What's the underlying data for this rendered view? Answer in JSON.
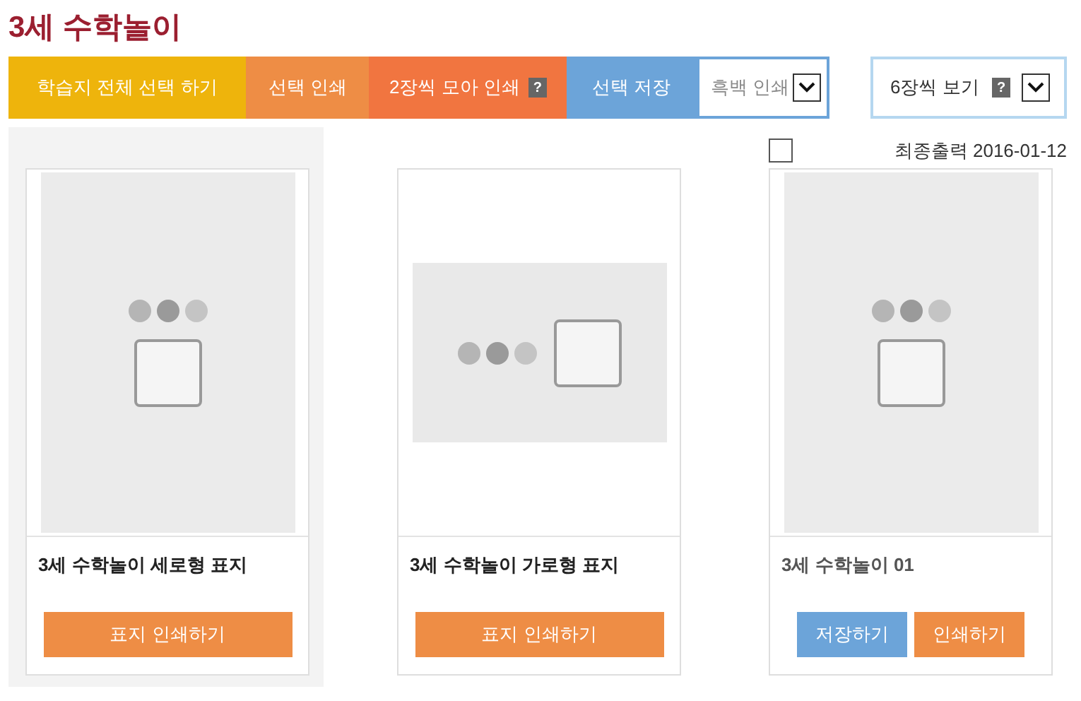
{
  "title": "3세 수학놀이",
  "toolbar": {
    "buttons": [
      {
        "label": "학습지 전체 선택 하기",
        "kind": "select-all"
      },
      {
        "label": "선택 인쇄",
        "kind": "print"
      },
      {
        "label": "2장씩 모아 인쇄",
        "kind": "print-two",
        "help": "?"
      },
      {
        "label": "선택 저장",
        "kind": "save"
      }
    ],
    "print_mode": {
      "value": "흑백 인쇄"
    },
    "view": {
      "value": "6장씩 보기",
      "help": "?"
    }
  },
  "cards": [
    {
      "kind": "cover",
      "preview": {
        "kind": "portrait"
      },
      "highlighted": true,
      "name": "3세 수학놀이 세로형 표지",
      "buttons": [
        {
          "label": "표지 인쇄하기",
          "kind": "print"
        }
      ]
    },
    {
      "kind": "cover",
      "preview": {
        "kind": "landscape"
      },
      "highlighted": false,
      "name": "3세 수학놀이 가로형 표지",
      "buttons": [
        {
          "label": "표지 인쇄하기",
          "kind": "print"
        }
      ]
    },
    {
      "kind": "worksheet",
      "preview": {
        "kind": "portrait"
      },
      "highlighted": false,
      "checked": false,
      "last_print": "최종출력 2016-01-12",
      "name": "3세 수학놀이 01",
      "buttons": [
        {
          "label": "저장하기",
          "kind": "save"
        },
        {
          "label": "인쇄하기",
          "kind": "print"
        }
      ]
    }
  ]
}
